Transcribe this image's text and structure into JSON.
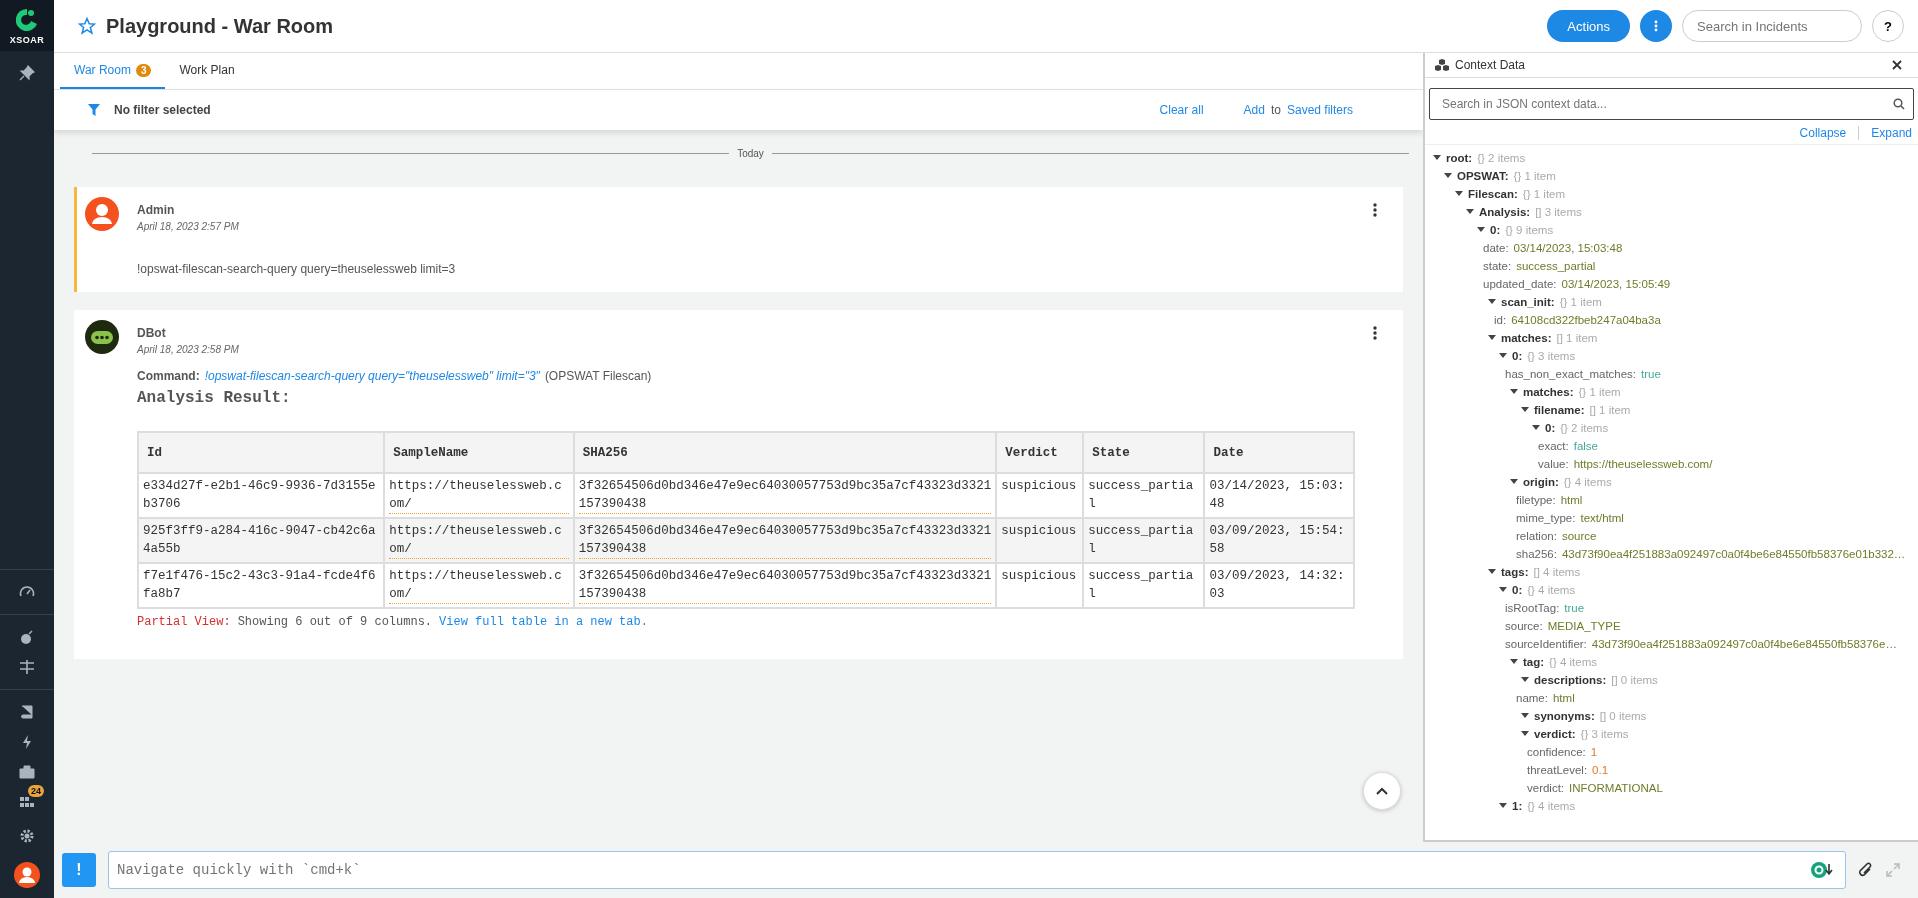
{
  "app": {
    "logo_text": "XSOAR",
    "notification_count": "24"
  },
  "header": {
    "title": "Playground - War Room",
    "favorite": false,
    "actions_button": "Actions",
    "search": {
      "placeholder": "Search in Incidents"
    },
    "help_button": "?"
  },
  "tabs": [
    {
      "label": "War Room",
      "badge": "3",
      "selected": true
    },
    {
      "label": "Work Plan",
      "selected": false
    }
  ],
  "filter_bar": {
    "status": "No filter selected",
    "clear": "Clear all",
    "add": "Add",
    "to": "to",
    "saved": "Saved filters"
  },
  "divider": "Today",
  "entries": [
    {
      "kind": "user",
      "author": "Admin",
      "time": "April 18, 2023 2:57 PM",
      "highlighted": true,
      "body": "!opswat-filescan-search-query query=theuselessweb limit=3"
    },
    {
      "kind": "bot",
      "author": "DBot",
      "time": "April 18, 2023 2:58 PM",
      "highlighted": false,
      "command_label": "Command:",
      "command": "!opswat-filescan-search-query query=\"theuselessweb\" limit=\"3\"",
      "source": "(OPSWAT Filescan)",
      "heading": "Analysis Result:",
      "table": {
        "columns": [
          {
            "label": "Id",
            "kind": "text"
          },
          {
            "label": "SampleName",
            "kind": "link"
          },
          {
            "label": "SHA256",
            "kind": "link"
          },
          {
            "label": "Verdict",
            "kind": "text"
          },
          {
            "label": "State",
            "kind": "text"
          },
          {
            "label": "Date",
            "kind": "text"
          }
        ],
        "rows": [
          [
            "e334d27f-e2b1-46c9-9936-7d3155eb3706",
            "https://theuselessweb.com/",
            "3f32654506d0bd346e47e9ec64030057753d9bc35a7cf43323d3321157390438",
            "suspicious",
            "success_partial",
            "03/14/2023, 15:03:48"
          ],
          [
            "925f3ff9-a284-416c-9047-cb42c6a4a55b",
            "https://theuselessweb.com/",
            "3f32654506d0bd346e47e9ec64030057753d9bc35a7cf43323d3321157390438",
            "suspicious",
            "success_partial",
            "03/09/2023, 15:54:58"
          ],
          [
            "f7e1f476-15c2-43c3-91a4-fcde4f6fa8b7",
            "https://theuselessweb.com/",
            "3f32654506d0bd346e47e9ec64030057753d9bc35a7cf43323d3321157390438",
            "suspicious",
            "success_partial",
            "03/09/2023, 14:32:03"
          ]
        ]
      },
      "note": {
        "label": "Partial View:",
        "text": "Showing 6 out of 9 columns.",
        "link": "View full table in a new tab."
      }
    }
  ],
  "context": {
    "title": "Context Data",
    "search": {
      "placeholder": "Search in JSON context data..."
    },
    "collapse": "Collapse",
    "expand": "Expand",
    "tree": {
      "key": "root:",
      "summary": "{} 2 items",
      "expanded": true,
      "children": [
        {
          "key": "OPSWAT:",
          "summary": "{} 1 item",
          "expanded": true,
          "children": [
            {
              "key": "Filescan:",
              "summary": "{} 1 item",
              "expanded": true,
              "children": [
                {
                  "key": "Analysis:",
                  "summary": "[] 3 items",
                  "expanded": true,
                  "children": [
                    {
                      "key": "0:",
                      "summary": "{} 9 items",
                      "expanded": true,
                      "children": [
                        {
                          "key": "date:",
                          "value": "03/14/2023, 15:03:48",
                          "kind": "string"
                        },
                        {
                          "key": "state:",
                          "value": "success_partial",
                          "kind": "string"
                        },
                        {
                          "key": "updated_date:",
                          "value": "03/14/2023, 15:05:49",
                          "kind": "string"
                        },
                        {
                          "key": "scan_init:",
                          "summary": "{} 1 item",
                          "expanded": true,
                          "children": [
                            {
                              "key": "id:",
                              "value": "64108cd322fbeb247a04ba3a",
                              "kind": "string"
                            }
                          ]
                        },
                        {
                          "key": "matches:",
                          "summary": "[] 1 item",
                          "expanded": true,
                          "children": [
                            {
                              "key": "0:",
                              "summary": "{} 3 items",
                              "expanded": true,
                              "children": [
                                {
                                  "key": "has_non_exact_matches:",
                                  "value": "true",
                                  "kind": "boolean"
                                },
                                {
                                  "key": "matches:",
                                  "summary": "{} 1 item",
                                  "expanded": true,
                                  "children": [
                                    {
                                      "key": "filename:",
                                      "summary": "[] 1 item",
                                      "expanded": true,
                                      "children": [
                                        {
                                          "key": "0:",
                                          "summary": "{} 2 items",
                                          "expanded": true,
                                          "children": [
                                            {
                                              "key": "exact:",
                                              "value": "false",
                                              "kind": "boolean"
                                            },
                                            {
                                              "key": "value:",
                                              "value": "https://theuselessweb.com/",
                                              "kind": "string"
                                            }
                                          ]
                                        }
                                      ]
                                    }
                                  ]
                                },
                                {
                                  "key": "origin:",
                                  "summary": "{} 4 items",
                                  "expanded": true,
                                  "children": [
                                    {
                                      "key": "filetype:",
                                      "value": "html",
                                      "kind": "string"
                                    },
                                    {
                                      "key": "mime_type:",
                                      "value": "text/html",
                                      "kind": "string"
                                    },
                                    {
                                      "key": "relation:",
                                      "value": "source",
                                      "kind": "string"
                                    },
                                    {
                                      "key": "sha256:",
                                      "value": "43d73f90ea4f251883a092497c0a0f4be6e84550fb58376e01b332…",
                                      "kind": "string"
                                    }
                                  ]
                                }
                              ]
                            }
                          ]
                        },
                        {
                          "key": "tags:",
                          "summary": "[] 4 items",
                          "expanded": true,
                          "children": [
                            {
                              "key": "0:",
                              "summary": "{} 4 items",
                              "expanded": true,
                              "children": [
                                {
                                  "key": "isRootTag:",
                                  "value": "true",
                                  "kind": "boolean"
                                },
                                {
                                  "key": "source:",
                                  "value": "MEDIA_TYPE",
                                  "kind": "string"
                                },
                                {
                                  "key": "sourceIdentifier:",
                                  "value": "43d73f90ea4f251883a092497c0a0f4be6e84550fb58376e…",
                                  "kind": "string"
                                },
                                {
                                  "key": "tag:",
                                  "summary": "{} 4 items",
                                  "expanded": true,
                                  "children": [
                                    {
                                      "key": "descriptions:",
                                      "summary": "[] 0 items",
                                      "expanded": true
                                    },
                                    {
                                      "key": "name:",
                                      "value": "html",
                                      "kind": "string"
                                    },
                                    {
                                      "key": "synonyms:",
                                      "summary": "[] 0 items",
                                      "expanded": true
                                    },
                                    {
                                      "key": "verdict:",
                                      "summary": "{} 3 items",
                                      "expanded": true,
                                      "children": [
                                        {
                                          "key": "confidence:",
                                          "value": "1",
                                          "kind": "number"
                                        },
                                        {
                                          "key": "threatLevel:",
                                          "value": "0.1",
                                          "kind": "number"
                                        },
                                        {
                                          "key": "verdict:",
                                          "value": "INFORMATIONAL",
                                          "kind": "string"
                                        }
                                      ]
                                    }
                                  ]
                                }
                              ]
                            },
                            {
                              "key": "1:",
                              "summary": "{} 4 items",
                              "expanded": true
                            }
                          ]
                        }
                      ]
                    }
                  ]
                }
              ]
            }
          ]
        }
      ]
    }
  },
  "command_bar": {
    "button": "!",
    "placeholder": "Navigate quickly with `cmd+k`"
  }
}
